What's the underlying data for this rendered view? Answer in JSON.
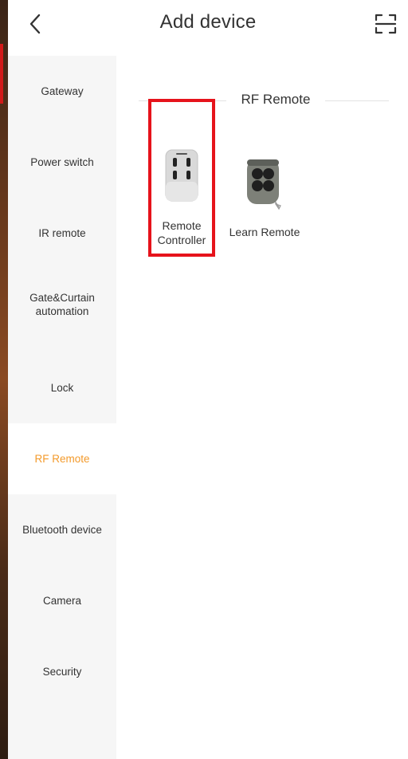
{
  "header": {
    "title": "Add device",
    "back_icon": "chevron-left-icon",
    "scan_icon": "scan-icon"
  },
  "sidebar": {
    "items": [
      {
        "label": "Gateway"
      },
      {
        "label": "Power switch"
      },
      {
        "label": "IR remote"
      },
      {
        "label": "Gate&Curtain automation"
      },
      {
        "label": "Lock"
      },
      {
        "label": "RF Remote",
        "active": true
      },
      {
        "label": "Bluetooth device"
      },
      {
        "label": "Camera"
      },
      {
        "label": "Security"
      }
    ]
  },
  "content": {
    "section_title": "RF Remote",
    "devices": [
      {
        "label_line1": "Remote",
        "label_line2": "Controller",
        "icon": "remote-controller-icon"
      },
      {
        "label_line1": "Learn Remote",
        "icon": "learn-remote-icon"
      }
    ]
  },
  "colors": {
    "active": "#f39a2b",
    "highlight": "#e6131b",
    "sidebar_bg": "#f6f6f6",
    "text": "#333333"
  }
}
